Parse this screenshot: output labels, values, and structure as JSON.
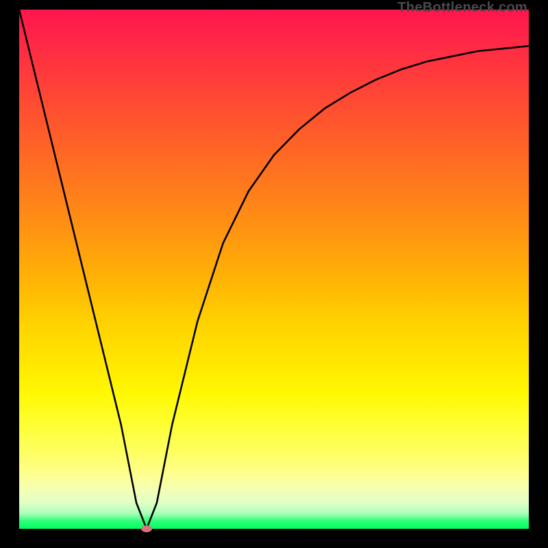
{
  "watermark": "TheBottleneck.com",
  "chart_data": {
    "type": "line",
    "title": "",
    "xlabel": "",
    "ylabel": "",
    "xlim": [
      0,
      100
    ],
    "ylim": [
      0,
      100
    ],
    "grid": false,
    "legend": false,
    "annotations": [],
    "series": [
      {
        "name": "curve",
        "x": [
          0,
          5,
          10,
          15,
          20,
          23,
          25,
          27,
          30,
          35,
          40,
          45,
          50,
          55,
          60,
          65,
          70,
          75,
          80,
          85,
          90,
          95,
          100
        ],
        "values": [
          100,
          80,
          60,
          40,
          20,
          5,
          0,
          5,
          20,
          40,
          55,
          65,
          72,
          77,
          81,
          84,
          86.5,
          88.5,
          90,
          91,
          92,
          92.5,
          93
        ]
      }
    ],
    "marker": {
      "x": 25,
      "y": 0,
      "color": "#d8707e"
    }
  }
}
